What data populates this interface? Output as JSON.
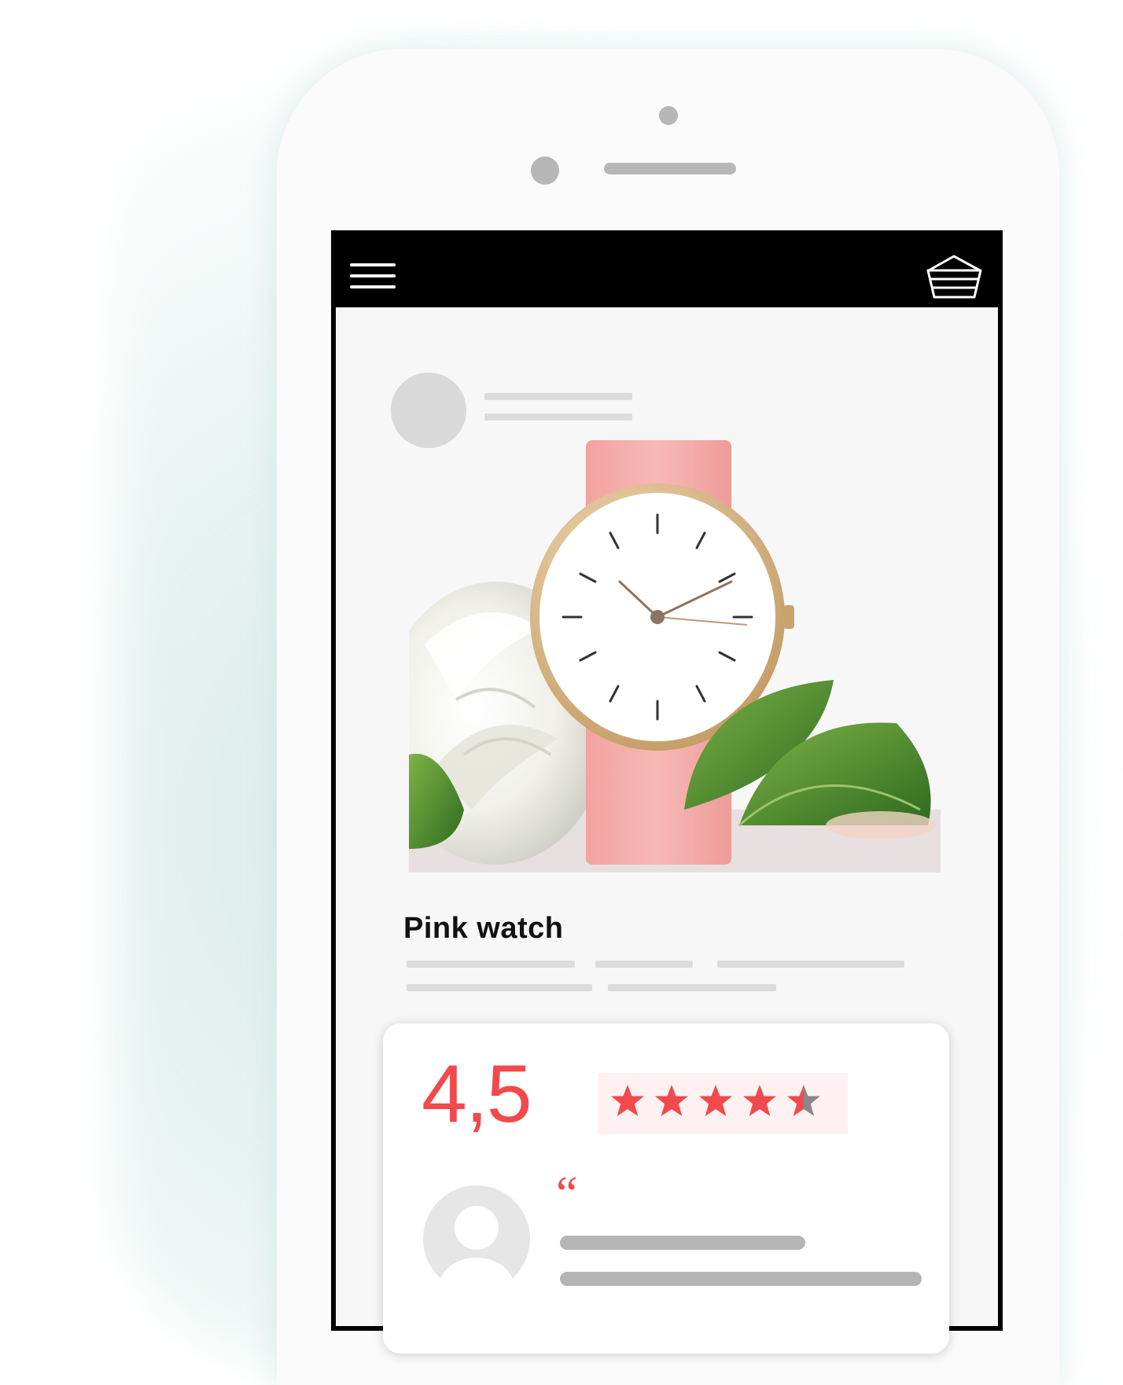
{
  "product": {
    "title": "Pink watch"
  },
  "rating": {
    "value_label": "4,5",
    "value": 4.5,
    "max": 5
  },
  "review": {
    "quote_mark": "“"
  },
  "icons": {
    "menu": "hamburger-menu-icon",
    "cart": "basket-icon",
    "star": "star-icon",
    "user": "user-avatar-icon"
  },
  "colors": {
    "accent": "#f2494c",
    "topbar": "#000000",
    "star_empty": "#888888",
    "star_bg": "#fff1f1"
  }
}
